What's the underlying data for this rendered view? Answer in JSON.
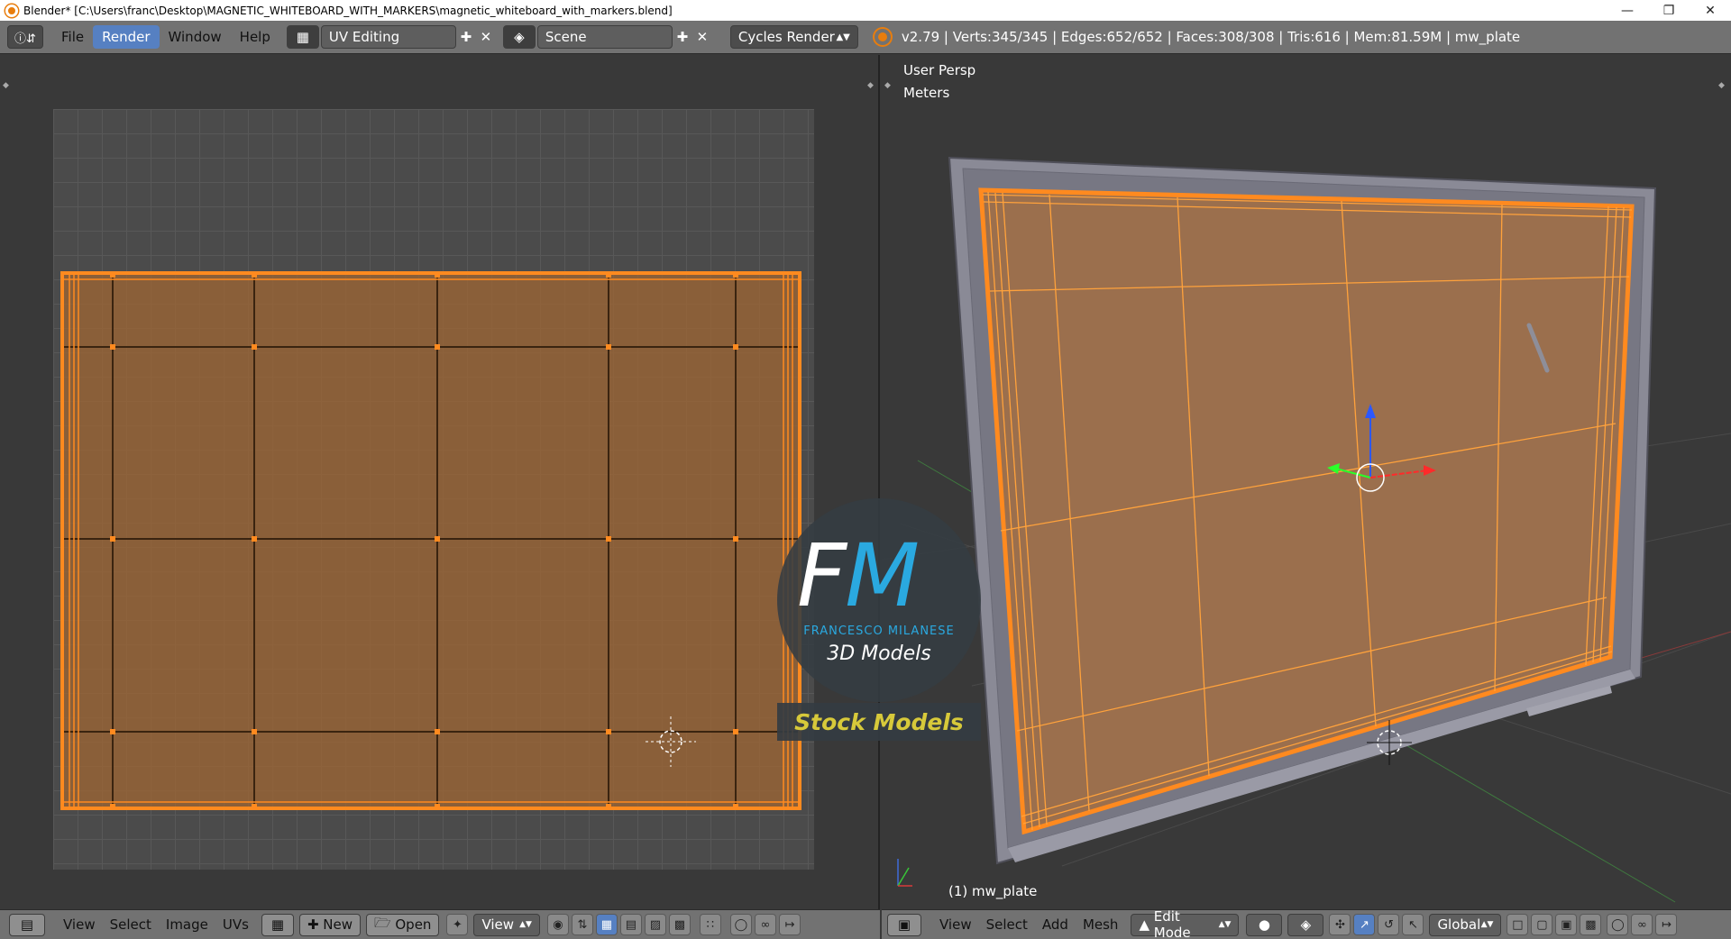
{
  "window": {
    "title": "Blender* [C:\\Users\\franc\\Desktop\\MAGNETIC_WHITEBOARD_WITH_MARKERS\\magnetic_whiteboard_with_markers.blend]",
    "controls": [
      "minimize",
      "restore",
      "close"
    ]
  },
  "info_header": {
    "menus": [
      "File",
      "Render",
      "Window",
      "Help"
    ],
    "active_menu": "Render",
    "layout": "UV Editing",
    "scene": "Scene",
    "engine": "Cycles Render",
    "stats": "v2.79 | Verts:345/345 | Edges:652/652 | Faces:308/308 | Tris:616 | Mem:81.59M | mw_plate"
  },
  "uv_editor": {
    "footer": {
      "menus": [
        "View",
        "Select",
        "Image",
        "UVs"
      ],
      "new_label": "New",
      "open_label": "Open",
      "view_label": "View"
    }
  },
  "view3d": {
    "view_name": "User Persp",
    "units": "Meters",
    "object_label": "(1) mw_plate",
    "footer": {
      "menus": [
        "View",
        "Select",
        "Add",
        "Mesh"
      ],
      "mode": "Edit Mode",
      "orientation": "Global"
    }
  },
  "watermark": {
    "letters_f": "F",
    "letters_m": "M",
    "name": "FRANCESCO MILANESE",
    "subtitle": "3D Models",
    "banner": "Stock Models"
  },
  "colors": {
    "selection_orange": "#ff8a1f",
    "active_blue": "#5680c2",
    "header_gray": "#727272"
  }
}
